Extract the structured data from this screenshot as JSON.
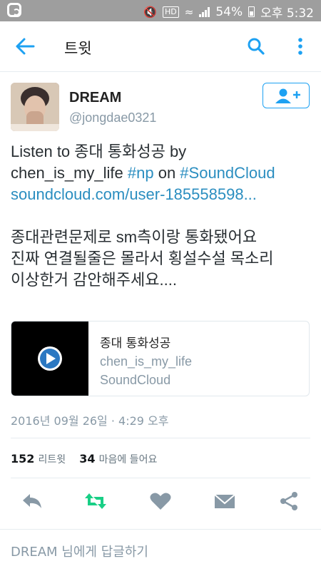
{
  "status_bar": {
    "battery": "54%",
    "time": "오후 5:32",
    "hd_label": "HD"
  },
  "appbar": {
    "title": "트윗"
  },
  "author": {
    "name": "DREAM",
    "handle": "@jongdae0321"
  },
  "tweet": {
    "line1_prefix": "Listen to 종대 통화성공 by",
    "line2_user": "chen_is_my_life ",
    "line2_tag_np": "#np",
    "line2_on": " on ",
    "line2_tag_sc": "#SoundCloud",
    "line3_link": "soundcloud.com/user-185558598...",
    "para2_line1": "종대관련문제로 sm측이랑 통화됐어요",
    "para2_line2": "진짜 연결될줄은 몰라서 횡설수설 목소리",
    "para2_line3": "이상한거 감안해주세요...."
  },
  "card": {
    "title": "종대 통화성공",
    "user": "chen_is_my_life",
    "source": "SoundCloud"
  },
  "timestamp": "2016년 09월 26일 · 4:29 오후",
  "stats": {
    "retweets_count": "152",
    "retweets_label": "리트윗",
    "likes_count": "34",
    "likes_label": "마음에 들어요"
  },
  "reply": {
    "placeholder": "DREAM 님에게 답글하기"
  },
  "colors": {
    "accent": "#1da1f2",
    "retweet_green": "#19cf86",
    "icon_gray": "#8899a6"
  }
}
